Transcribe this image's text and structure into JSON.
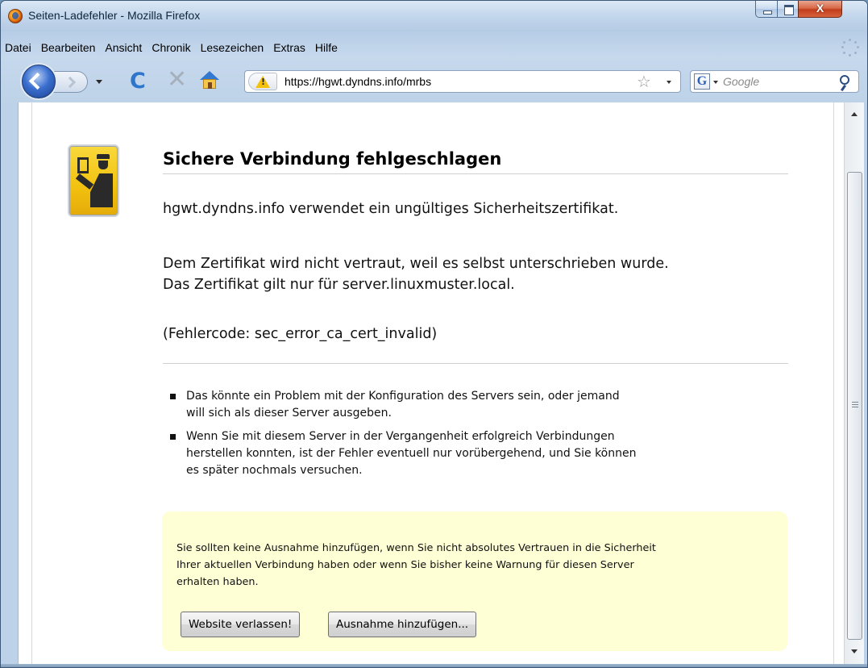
{
  "window": {
    "title": "Seiten-Ladefehler - Mozilla Firefox",
    "close_label": "X"
  },
  "menu": [
    "Datei",
    "Bearbeiten",
    "Ansicht",
    "Chronik",
    "Lesezeichen",
    "Extras",
    "Hilfe"
  ],
  "toolbar": {
    "url": "https://hgwt.dyndns.info/mrbs",
    "search_engine": "G",
    "search_placeholder": "Google",
    "icons": [
      "back-arrow",
      "forward-arrow",
      "reload",
      "stop",
      "home",
      "warning",
      "star",
      "magnifier"
    ]
  },
  "error": {
    "title": "Sichere Verbindung fehlgeschlagen",
    "lead_1": "hgwt.dyndns.info verwendet ein ungültiges Sicherheitszertifikat.",
    "lead_2": "Dem Zertifikat wird nicht vertraut, weil es selbst unterschrieben wurde.",
    "lead_3": "Das Zertifikat gilt nur für server.linuxmuster.local.",
    "lead_4": "(Fehlercode: sec_error_ca_cert_invalid)",
    "bullets": [
      {
        "line1": "Das könnte ein Problem mit der Konfiguration des Servers sein, oder jemand",
        "line2": "will sich als dieser Server ausgeben.",
        "line3": ""
      },
      {
        "line1": "Wenn Sie mit diesem Server in der Vergangenheit erfolgreich Verbindungen",
        "line2": "herstellen konnten, ist der Fehler eventuell nur vorübergehend, und Sie können",
        "line3": "es später nochmals versuchen."
      }
    ],
    "warning_1": "Sie sollten keine Ausnahme hinzufügen, wenn Sie nicht absolutes Vertrauen in die Sicherheit",
    "warning_2": "Ihrer aktuellen Verbindung haben oder wenn Sie bisher keine Warnung für diesen Server",
    "warning_3": "erhalten haben.",
    "button_leave": "Website verlassen!",
    "button_add_exception": "Ausnahme hinzufügen..."
  },
  "colors": {
    "warning_bg": "#ffffd6",
    "accent": "#2e75cc",
    "cert_icon": "#f2c10f"
  }
}
